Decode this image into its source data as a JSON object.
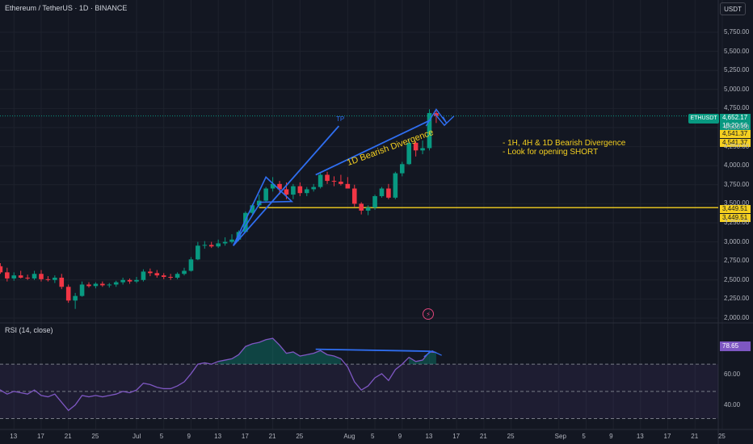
{
  "header": {
    "title": "Ethereum / TetherUS · 1D · BINANCE",
    "currency": "USDT"
  },
  "rsi": {
    "title": "RSI (14, close)",
    "value_label": "78.65",
    "ticks": [
      "60.00",
      "40.00"
    ]
  },
  "annotations": {
    "tp_label": "TP",
    "divergence_label": "1D Bearish Divergence",
    "note_line1": "- 1H, 4H & 1D Bearish Divergence",
    "note_line2": "- Look for opening SHORT"
  },
  "price_tags": {
    "symbol": "ETHUSDT",
    "last_price": "4,652.17",
    "countdown": "18:20:56",
    "upper_level_a": "4,541.37",
    "upper_level_b": "4,541.37",
    "lower_level_a": "3,449.51",
    "lower_level_b": "3,449.51"
  },
  "colors": {
    "background": "#131722",
    "up": "#089981",
    "down": "#f23645",
    "annotation_blue": "#2f6ef0",
    "annotation_yellow": "#f5d020",
    "rsi_line": "#7e57c2"
  },
  "icons": {
    "lightning": "lightning-icon"
  },
  "chart_data": {
    "type": "candlestick",
    "title": "Ethereum / TetherUS · 1D · BINANCE",
    "y_ticks": [
      2000,
      2250,
      2500,
      2750,
      3000,
      3250,
      3500,
      3750,
      4000,
      4250,
      4500,
      4750,
      5000,
      5250,
      5500,
      5750
    ],
    "y_tick_labels": [
      "2,000.00",
      "2,250.00",
      "2,500.00",
      "2,750.00",
      "3,000.00",
      "3,250.00",
      "3,500.00",
      "3,750.00",
      "4,000.00",
      "4,250.00",
      "4,500.00",
      "4,750.00",
      "5,000.00",
      "5,250.00",
      "5,500.00",
      "5,750.00"
    ],
    "x_tick_labels": [
      {
        "label": "13",
        "day": -18
      },
      {
        "label": "17",
        "day": -14
      },
      {
        "label": "21",
        "day": -10
      },
      {
        "label": "25",
        "day": -6
      },
      {
        "label": "Jul",
        "day": 0
      },
      {
        "label": "5",
        "day": 4
      },
      {
        "label": "9",
        "day": 8
      },
      {
        "label": "13",
        "day": 12
      },
      {
        "label": "17",
        "day": 16
      },
      {
        "label": "21",
        "day": 20
      },
      {
        "label": "25",
        "day": 24
      },
      {
        "label": "Aug",
        "day": 31
      },
      {
        "label": "5",
        "day": 35
      },
      {
        "label": "9",
        "day": 39
      },
      {
        "label": "13",
        "day": 43
      },
      {
        "label": "17",
        "day": 47
      },
      {
        "label": "21",
        "day": 51
      },
      {
        "label": "25",
        "day": 55
      },
      {
        "label": "Sep",
        "day": 62
      },
      {
        "label": "5",
        "day": 66
      },
      {
        "label": "9",
        "day": 70
      },
      {
        "label": "13",
        "day": 74
      },
      {
        "label": "17",
        "day": 78
      },
      {
        "label": "21",
        "day": 82
      },
      {
        "label": "25",
        "day": 86
      }
    ],
    "candles": [
      {
        "day": -22,
        "o": 2820,
        "h": 2880,
        "l": 2720,
        "c": 2760
      },
      {
        "day": -21,
        "o": 2760,
        "h": 2800,
        "l": 2640,
        "c": 2680
      },
      {
        "day": -20,
        "o": 2680,
        "h": 2720,
        "l": 2580,
        "c": 2600
      },
      {
        "day": -19,
        "o": 2600,
        "h": 2660,
        "l": 2480,
        "c": 2520
      },
      {
        "day": -18,
        "o": 2520,
        "h": 2600,
        "l": 2490,
        "c": 2560
      },
      {
        "day": -17,
        "o": 2560,
        "h": 2620,
        "l": 2520,
        "c": 2530
      },
      {
        "day": -16,
        "o": 2530,
        "h": 2570,
        "l": 2500,
        "c": 2520
      },
      {
        "day": -15,
        "o": 2520,
        "h": 2620,
        "l": 2500,
        "c": 2580
      },
      {
        "day": -14,
        "o": 2580,
        "h": 2630,
        "l": 2480,
        "c": 2510
      },
      {
        "day": -13,
        "o": 2510,
        "h": 2550,
        "l": 2480,
        "c": 2500
      },
      {
        "day": -12,
        "o": 2500,
        "h": 2560,
        "l": 2460,
        "c": 2530
      },
      {
        "day": -11,
        "o": 2530,
        "h": 2580,
        "l": 2380,
        "c": 2410
      },
      {
        "day": -10,
        "o": 2410,
        "h": 2440,
        "l": 2200,
        "c": 2230
      },
      {
        "day": -9,
        "o": 2230,
        "h": 2330,
        "l": 2120,
        "c": 2290
      },
      {
        "day": -8,
        "o": 2290,
        "h": 2480,
        "l": 2280,
        "c": 2440
      },
      {
        "day": -7,
        "o": 2440,
        "h": 2470,
        "l": 2400,
        "c": 2420
      },
      {
        "day": -6,
        "o": 2420,
        "h": 2470,
        "l": 2390,
        "c": 2450
      },
      {
        "day": -5,
        "o": 2450,
        "h": 2480,
        "l": 2410,
        "c": 2430
      },
      {
        "day": -4,
        "o": 2430,
        "h": 2460,
        "l": 2400,
        "c": 2440
      },
      {
        "day": -3,
        "o": 2440,
        "h": 2490,
        "l": 2410,
        "c": 2470
      },
      {
        "day": -2,
        "o": 2470,
        "h": 2530,
        "l": 2440,
        "c": 2500
      },
      {
        "day": -1,
        "o": 2500,
        "h": 2520,
        "l": 2450,
        "c": 2480
      },
      {
        "day": 0,
        "o": 2480,
        "h": 2540,
        "l": 2460,
        "c": 2500
      },
      {
        "day": 1,
        "o": 2500,
        "h": 2640,
        "l": 2480,
        "c": 2610
      },
      {
        "day": 2,
        "o": 2610,
        "h": 2650,
        "l": 2550,
        "c": 2590
      },
      {
        "day": 3,
        "o": 2590,
        "h": 2630,
        "l": 2530,
        "c": 2560
      },
      {
        "day": 4,
        "o": 2560,
        "h": 2590,
        "l": 2510,
        "c": 2540
      },
      {
        "day": 5,
        "o": 2540,
        "h": 2580,
        "l": 2500,
        "c": 2530
      },
      {
        "day": 6,
        "o": 2530,
        "h": 2600,
        "l": 2510,
        "c": 2580
      },
      {
        "day": 7,
        "o": 2580,
        "h": 2660,
        "l": 2560,
        "c": 2620
      },
      {
        "day": 8,
        "o": 2620,
        "h": 2800,
        "l": 2610,
        "c": 2770
      },
      {
        "day": 9,
        "o": 2770,
        "h": 3000,
        "l": 2760,
        "c": 2950
      },
      {
        "day": 10,
        "o": 2950,
        "h": 3010,
        "l": 2910,
        "c": 2960
      },
      {
        "day": 11,
        "o": 2960,
        "h": 3000,
        "l": 2920,
        "c": 2940
      },
      {
        "day": 12,
        "o": 2940,
        "h": 3030,
        "l": 2920,
        "c": 2980
      },
      {
        "day": 13,
        "o": 2980,
        "h": 3060,
        "l": 2950,
        "c": 3000
      },
      {
        "day": 14,
        "o": 3000,
        "h": 3100,
        "l": 2980,
        "c": 3030
      },
      {
        "day": 15,
        "o": 3030,
        "h": 3150,
        "l": 3010,
        "c": 3130
      },
      {
        "day": 16,
        "o": 3130,
        "h": 3400,
        "l": 3120,
        "c": 3380
      },
      {
        "day": 17,
        "o": 3380,
        "h": 3500,
        "l": 3360,
        "c": 3480
      },
      {
        "day": 18,
        "o": 3480,
        "h": 3620,
        "l": 3460,
        "c": 3540
      },
      {
        "day": 19,
        "o": 3540,
        "h": 3720,
        "l": 3520,
        "c": 3700
      },
      {
        "day": 20,
        "o": 3700,
        "h": 3850,
        "l": 3660,
        "c": 3760
      },
      {
        "day": 21,
        "o": 3760,
        "h": 3800,
        "l": 3620,
        "c": 3690
      },
      {
        "day": 22,
        "o": 3690,
        "h": 3780,
        "l": 3560,
        "c": 3620
      },
      {
        "day": 23,
        "o": 3620,
        "h": 3760,
        "l": 3560,
        "c": 3730
      },
      {
        "day": 24,
        "o": 3730,
        "h": 3780,
        "l": 3600,
        "c": 3640
      },
      {
        "day": 25,
        "o": 3640,
        "h": 3720,
        "l": 3600,
        "c": 3690
      },
      {
        "day": 26,
        "o": 3690,
        "h": 3760,
        "l": 3660,
        "c": 3720
      },
      {
        "day": 27,
        "o": 3720,
        "h": 3900,
        "l": 3700,
        "c": 3880
      },
      {
        "day": 28,
        "o": 3880,
        "h": 3920,
        "l": 3760,
        "c": 3800
      },
      {
        "day": 29,
        "o": 3800,
        "h": 3860,
        "l": 3730,
        "c": 3790
      },
      {
        "day": 30,
        "o": 3790,
        "h": 3880,
        "l": 3740,
        "c": 3760
      },
      {
        "day": 31,
        "o": 3760,
        "h": 3850,
        "l": 3700,
        "c": 3700
      },
      {
        "day": 32,
        "o": 3700,
        "h": 3750,
        "l": 3460,
        "c": 3500
      },
      {
        "day": 33,
        "o": 3500,
        "h": 3520,
        "l": 3360,
        "c": 3410
      },
      {
        "day": 34,
        "o": 3410,
        "h": 3480,
        "l": 3350,
        "c": 3450
      },
      {
        "day": 35,
        "o": 3450,
        "h": 3620,
        "l": 3420,
        "c": 3600
      },
      {
        "day": 36,
        "o": 3600,
        "h": 3720,
        "l": 3580,
        "c": 3700
      },
      {
        "day": 37,
        "o": 3700,
        "h": 3760,
        "l": 3560,
        "c": 3580
      },
      {
        "day": 38,
        "o": 3580,
        "h": 3920,
        "l": 3560,
        "c": 3900
      },
      {
        "day": 39,
        "o": 3900,
        "h": 4050,
        "l": 3860,
        "c": 4020
      },
      {
        "day": 40,
        "o": 4020,
        "h": 4350,
        "l": 4010,
        "c": 4300
      },
      {
        "day": 41,
        "o": 4300,
        "h": 4320,
        "l": 4120,
        "c": 4200
      },
      {
        "day": 42,
        "o": 4200,
        "h": 4330,
        "l": 4150,
        "c": 4230
      },
      {
        "day": 43,
        "o": 4230,
        "h": 4740,
        "l": 4200,
        "c": 4690
      },
      {
        "day": 44,
        "o": 4690,
        "h": 4720,
        "l": 4560,
        "c": 4652
      }
    ],
    "horizontal_levels": [
      4541.37,
      3449.51
    ],
    "rsi": {
      "title": "RSI (14, close)",
      "ylim": [
        22,
        95
      ],
      "bands": [
        70,
        50,
        30
      ],
      "ticks": [
        60,
        40
      ],
      "last": 78.65,
      "values": [
        {
          "day": -22,
          "v": 56
        },
        {
          "day": -21,
          "v": 53
        },
        {
          "day": -20,
          "v": 51
        },
        {
          "day": -19,
          "v": 48
        },
        {
          "day": -18,
          "v": 50
        },
        {
          "day": -17,
          "v": 49
        },
        {
          "day": -16,
          "v": 48
        },
        {
          "day": -15,
          "v": 51
        },
        {
          "day": -14,
          "v": 47
        },
        {
          "day": -13,
          "v": 46
        },
        {
          "day": -12,
          "v": 48
        },
        {
          "day": -11,
          "v": 42
        },
        {
          "day": -10,
          "v": 36
        },
        {
          "day": -9,
          "v": 40
        },
        {
          "day": -8,
          "v": 47
        },
        {
          "day": -7,
          "v": 46
        },
        {
          "day": -6,
          "v": 47
        },
        {
          "day": -5,
          "v": 46
        },
        {
          "day": -4,
          "v": 47
        },
        {
          "day": -3,
          "v": 48
        },
        {
          "day": -2,
          "v": 50
        },
        {
          "day": -1,
          "v": 49
        },
        {
          "day": 0,
          "v": 51
        },
        {
          "day": 1,
          "v": 56
        },
        {
          "day": 2,
          "v": 55
        },
        {
          "day": 3,
          "v": 53
        },
        {
          "day": 4,
          "v": 52
        },
        {
          "day": 5,
          "v": 52
        },
        {
          "day": 6,
          "v": 54
        },
        {
          "day": 7,
          "v": 57
        },
        {
          "day": 8,
          "v": 63
        },
        {
          "day": 9,
          "v": 70
        },
        {
          "day": 10,
          "v": 71
        },
        {
          "day": 11,
          "v": 70
        },
        {
          "day": 12,
          "v": 72
        },
        {
          "day": 13,
          "v": 73
        },
        {
          "day": 14,
          "v": 74
        },
        {
          "day": 15,
          "v": 77
        },
        {
          "day": 16,
          "v": 83
        },
        {
          "day": 17,
          "v": 85
        },
        {
          "day": 18,
          "v": 86
        },
        {
          "day": 19,
          "v": 88
        },
        {
          "day": 20,
          "v": 89
        },
        {
          "day": 21,
          "v": 84
        },
        {
          "day": 22,
          "v": 78
        },
        {
          "day": 23,
          "v": 79
        },
        {
          "day": 24,
          "v": 76
        },
        {
          "day": 25,
          "v": 77
        },
        {
          "day": 26,
          "v": 78
        },
        {
          "day": 27,
          "v": 80
        },
        {
          "day": 28,
          "v": 77
        },
        {
          "day": 29,
          "v": 76
        },
        {
          "day": 30,
          "v": 74
        },
        {
          "day": 31,
          "v": 68
        },
        {
          "day": 32,
          "v": 57
        },
        {
          "day": 33,
          "v": 51
        },
        {
          "day": 34,
          "v": 54
        },
        {
          "day": 35,
          "v": 60
        },
        {
          "day": 36,
          "v": 63
        },
        {
          "day": 37,
          "v": 58
        },
        {
          "day": 38,
          "v": 66
        },
        {
          "day": 39,
          "v": 70
        },
        {
          "day": 40,
          "v": 75
        },
        {
          "day": 41,
          "v": 72
        },
        {
          "day": 42,
          "v": 73
        },
        {
          "day": 43,
          "v": 79
        },
        {
          "day": 44,
          "v": 78.65
        }
      ]
    }
  }
}
